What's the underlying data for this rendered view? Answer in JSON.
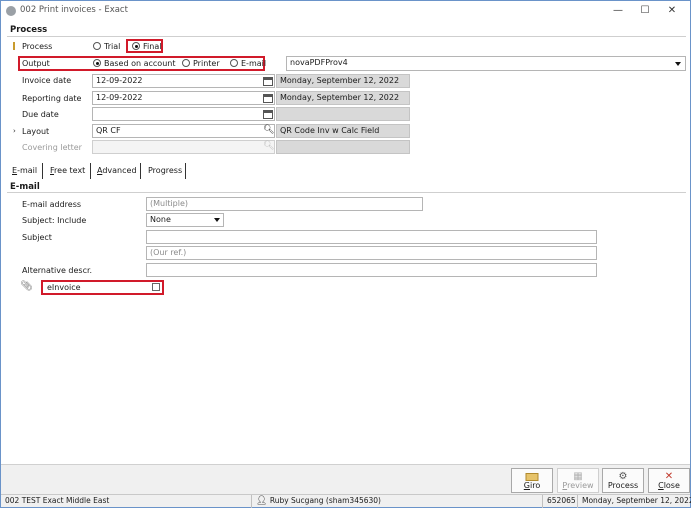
{
  "window": {
    "title": "002 Print invoices - Exact",
    "minimize": "—",
    "maximize": "☐",
    "close": "✕"
  },
  "process": {
    "heading": "Process",
    "process_label": "Process",
    "trial_label": "Trial",
    "final_label": "Final",
    "output_label": "Output",
    "based_on_account_label": "Based on account",
    "printer_label": "Printer",
    "email_label": "E-mail",
    "printer_value": "novaPDFProv4",
    "invoice_date_label": "Invoice date",
    "invoice_date_value": "12-09-2022",
    "invoice_date_text": "Monday, September 12, 2022",
    "reporting_date_label": "Reporting date",
    "reporting_date_value": "12-09-2022",
    "reporting_date_text": "Monday, September 12, 2022",
    "due_date_label": "Due date",
    "due_date_value": "",
    "layout_label": "Layout",
    "layout_value": "QR CF",
    "layout_desc": "QR Code Inv w Calc Field",
    "covering_letter_label": "Covering letter",
    "covering_letter_value": ""
  },
  "tabs": [
    {
      "first": "E",
      "rest": "-mail"
    },
    {
      "first": "F",
      "rest": "ree text"
    },
    {
      "first": "A",
      "rest": "dvanced"
    },
    {
      "first": "",
      "rest": "Progress"
    }
  ],
  "email": {
    "heading": "E-mail",
    "address_label": "E-mail address",
    "address_placeholder": "(Multiple)",
    "subject_include_label": "Subject: Include",
    "subject_include_value": "None",
    "subject_label": "Subject",
    "subject_value": "",
    "subject_ref_placeholder": "(Our ref.)",
    "alt_descr_label": "Alternative descr.",
    "alt_descr_value": "",
    "einvoice_label": "eInvoice"
  },
  "buttons": {
    "giro_u": "G",
    "giro_rest": "iro",
    "preview_u": "P",
    "preview_rest": "review",
    "process": "Process",
    "close_u": "C",
    "close_rest": "lose"
  },
  "statusbar": {
    "company": "002 TEST Exact Middle East",
    "user": "Ruby Sucgang (sham345630)",
    "code": "652065",
    "date": "Monday, September 12, 2022"
  },
  "colors": {
    "highlight_red": "#d11a2a",
    "close_icon_red": "#c0392b",
    "field_grey": "#d9d9d9",
    "required_marker": "#c89b2e"
  }
}
